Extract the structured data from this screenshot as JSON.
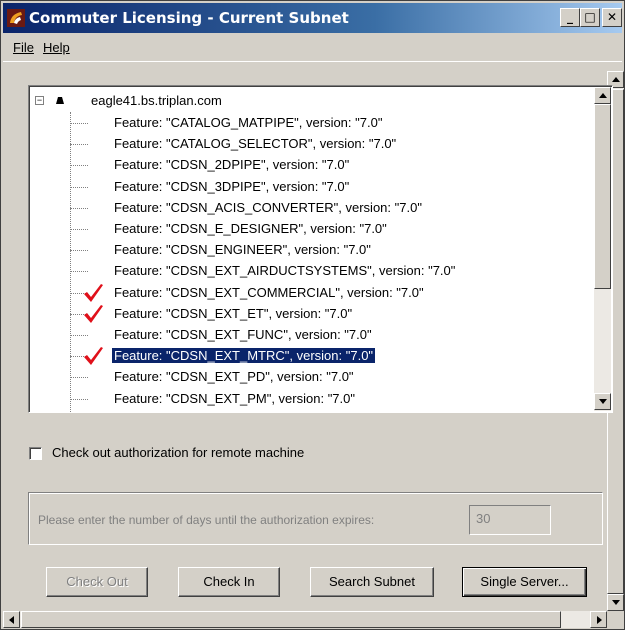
{
  "window": {
    "title": "Commuter Licensing - Current Subnet",
    "icon": "app-icon"
  },
  "menu": {
    "file_label": "File",
    "help_label": "Help"
  },
  "tree": {
    "host": "eagle41.bs.triplan.com",
    "features": [
      {
        "label": "Feature: \"CATALOG_MATPIPE\", version: \"7.0\"",
        "checked": false,
        "selected": false
      },
      {
        "label": "Feature: \"CATALOG_SELECTOR\", version: \"7.0\"",
        "checked": false,
        "selected": false
      },
      {
        "label": "Feature: \"CDSN_2DPIPE\", version: \"7.0\"",
        "checked": false,
        "selected": false
      },
      {
        "label": "Feature: \"CDSN_3DPIPE\", version: \"7.0\"",
        "checked": false,
        "selected": false
      },
      {
        "label": "Feature: \"CDSN_ACIS_CONVERTER\", version: \"7.0\"",
        "checked": false,
        "selected": false
      },
      {
        "label": "Feature: \"CDSN_E_DESIGNER\", version: \"7.0\"",
        "checked": false,
        "selected": false
      },
      {
        "label": "Feature: \"CDSN_ENGINEER\", version: \"7.0\"",
        "checked": false,
        "selected": false
      },
      {
        "label": "Feature: \"CDSN_EXT_AIRDUCTSYSTEMS\", version: \"7.0\"",
        "checked": false,
        "selected": false
      },
      {
        "label": "Feature: \"CDSN_EXT_COMMERCIAL\", version: \"7.0\"",
        "checked": true,
        "selected": false
      },
      {
        "label": "Feature: \"CDSN_EXT_ET\", version: \"7.0\"",
        "checked": true,
        "selected": false
      },
      {
        "label": "Feature: \"CDSN_EXT_FUNC\", version: \"7.0\"",
        "checked": false,
        "selected": false
      },
      {
        "label": "Feature: \"CDSN_EXT_MTRC\", version: \"7.0\"",
        "checked": true,
        "selected": true
      },
      {
        "label": "Feature: \"CDSN_EXT_PD\", version: \"7.0\"",
        "checked": false,
        "selected": false
      },
      {
        "label": "Feature: \"CDSN_EXT_PM\", version: \"7.0\"",
        "checked": false,
        "selected": false
      }
    ]
  },
  "remote": {
    "checkbox_label": "Check out authorization for remote machine",
    "checked": false
  },
  "expiry": {
    "prompt": "Please enter the number of days until the authorization expires:",
    "days_value": "30"
  },
  "buttons": {
    "check_out": "Check Out",
    "check_in": "Check In",
    "search_subnet": "Search Subnet",
    "single_server": "Single Server..."
  },
  "colors": {
    "selection": "#0a246a",
    "checkmark": "#e0101a",
    "titlebar_start": "#0a246a"
  }
}
